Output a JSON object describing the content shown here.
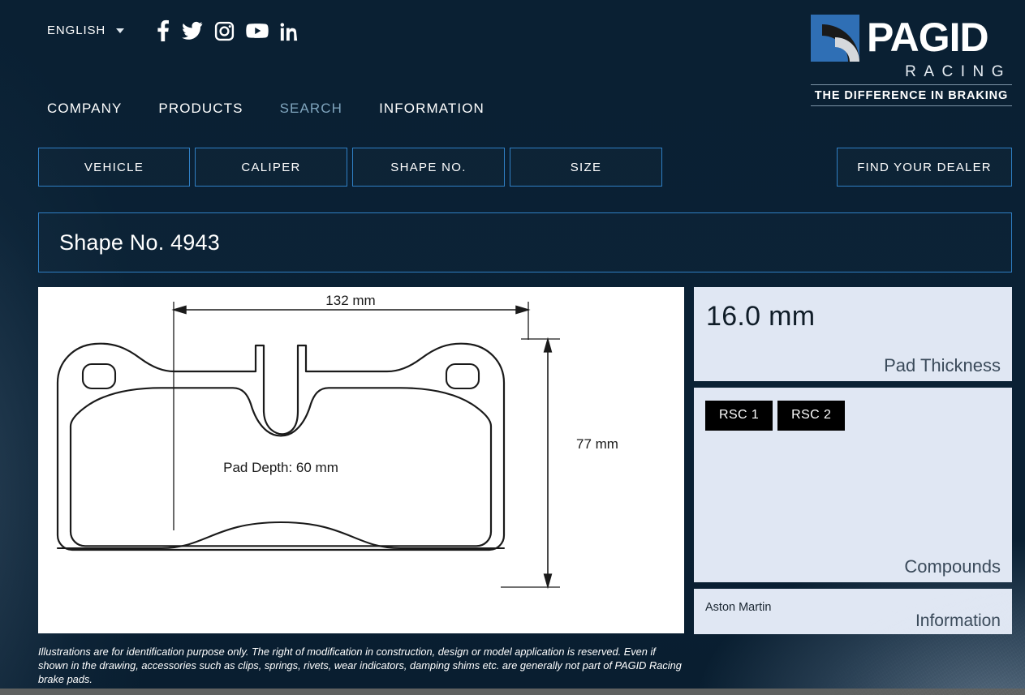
{
  "topbar": {
    "language": "ENGLISH",
    "language_caret": "chevron-down-icon",
    "social": [
      {
        "name": "facebook-icon",
        "label": "Facebook"
      },
      {
        "name": "twitter-icon",
        "label": "Twitter"
      },
      {
        "name": "instagram-icon",
        "label": "Instagram"
      },
      {
        "name": "youtube-icon",
        "label": "YouTube"
      },
      {
        "name": "linkedin-icon",
        "label": "LinkedIn"
      }
    ]
  },
  "logo": {
    "wordmark": "PAGID",
    "sub": "RACING",
    "tagline": "THE DIFFERENCE IN BRAKING"
  },
  "nav": [
    {
      "label": "COMPANY",
      "active": false
    },
    {
      "label": "PRODUCTS",
      "active": false
    },
    {
      "label": "SEARCH",
      "active": true
    },
    {
      "label": "INFORMATION",
      "active": false
    }
  ],
  "search_tabs": [
    {
      "label": "VEHICLE"
    },
    {
      "label": "CALIPER"
    },
    {
      "label": "SHAPE NO."
    },
    {
      "label": "SIZE"
    }
  ],
  "dealer_button": "FIND YOUR DEALER",
  "page_title": "Shape No. 4943",
  "drawing": {
    "width_label": "132 mm",
    "height_label": "77 mm",
    "depth_label": "Pad Depth: 60 mm"
  },
  "cards": {
    "thickness": {
      "value": "16.0 mm",
      "label": "Pad Thickness"
    },
    "compounds": {
      "label": "Compounds",
      "badges": [
        "RSC 1",
        "RSC 2"
      ]
    },
    "information": {
      "value": "Aston Martin",
      "label": "Information"
    }
  },
  "disclaimer": "Illustrations are for identification purpose only. The right of modification in construction, design or model application is reserved. Even if shown in the drawing, accessories such as clips, springs, rivets, wear indicators, damping shims etc. are generally not part of PAGID Racing brake pads.",
  "colors": {
    "background": "#0a2033",
    "accent_border": "#2f7fc4",
    "active_nav": "#7fa4bd",
    "card_bg": "#e0e7f3",
    "badge_bg": "#000000"
  }
}
